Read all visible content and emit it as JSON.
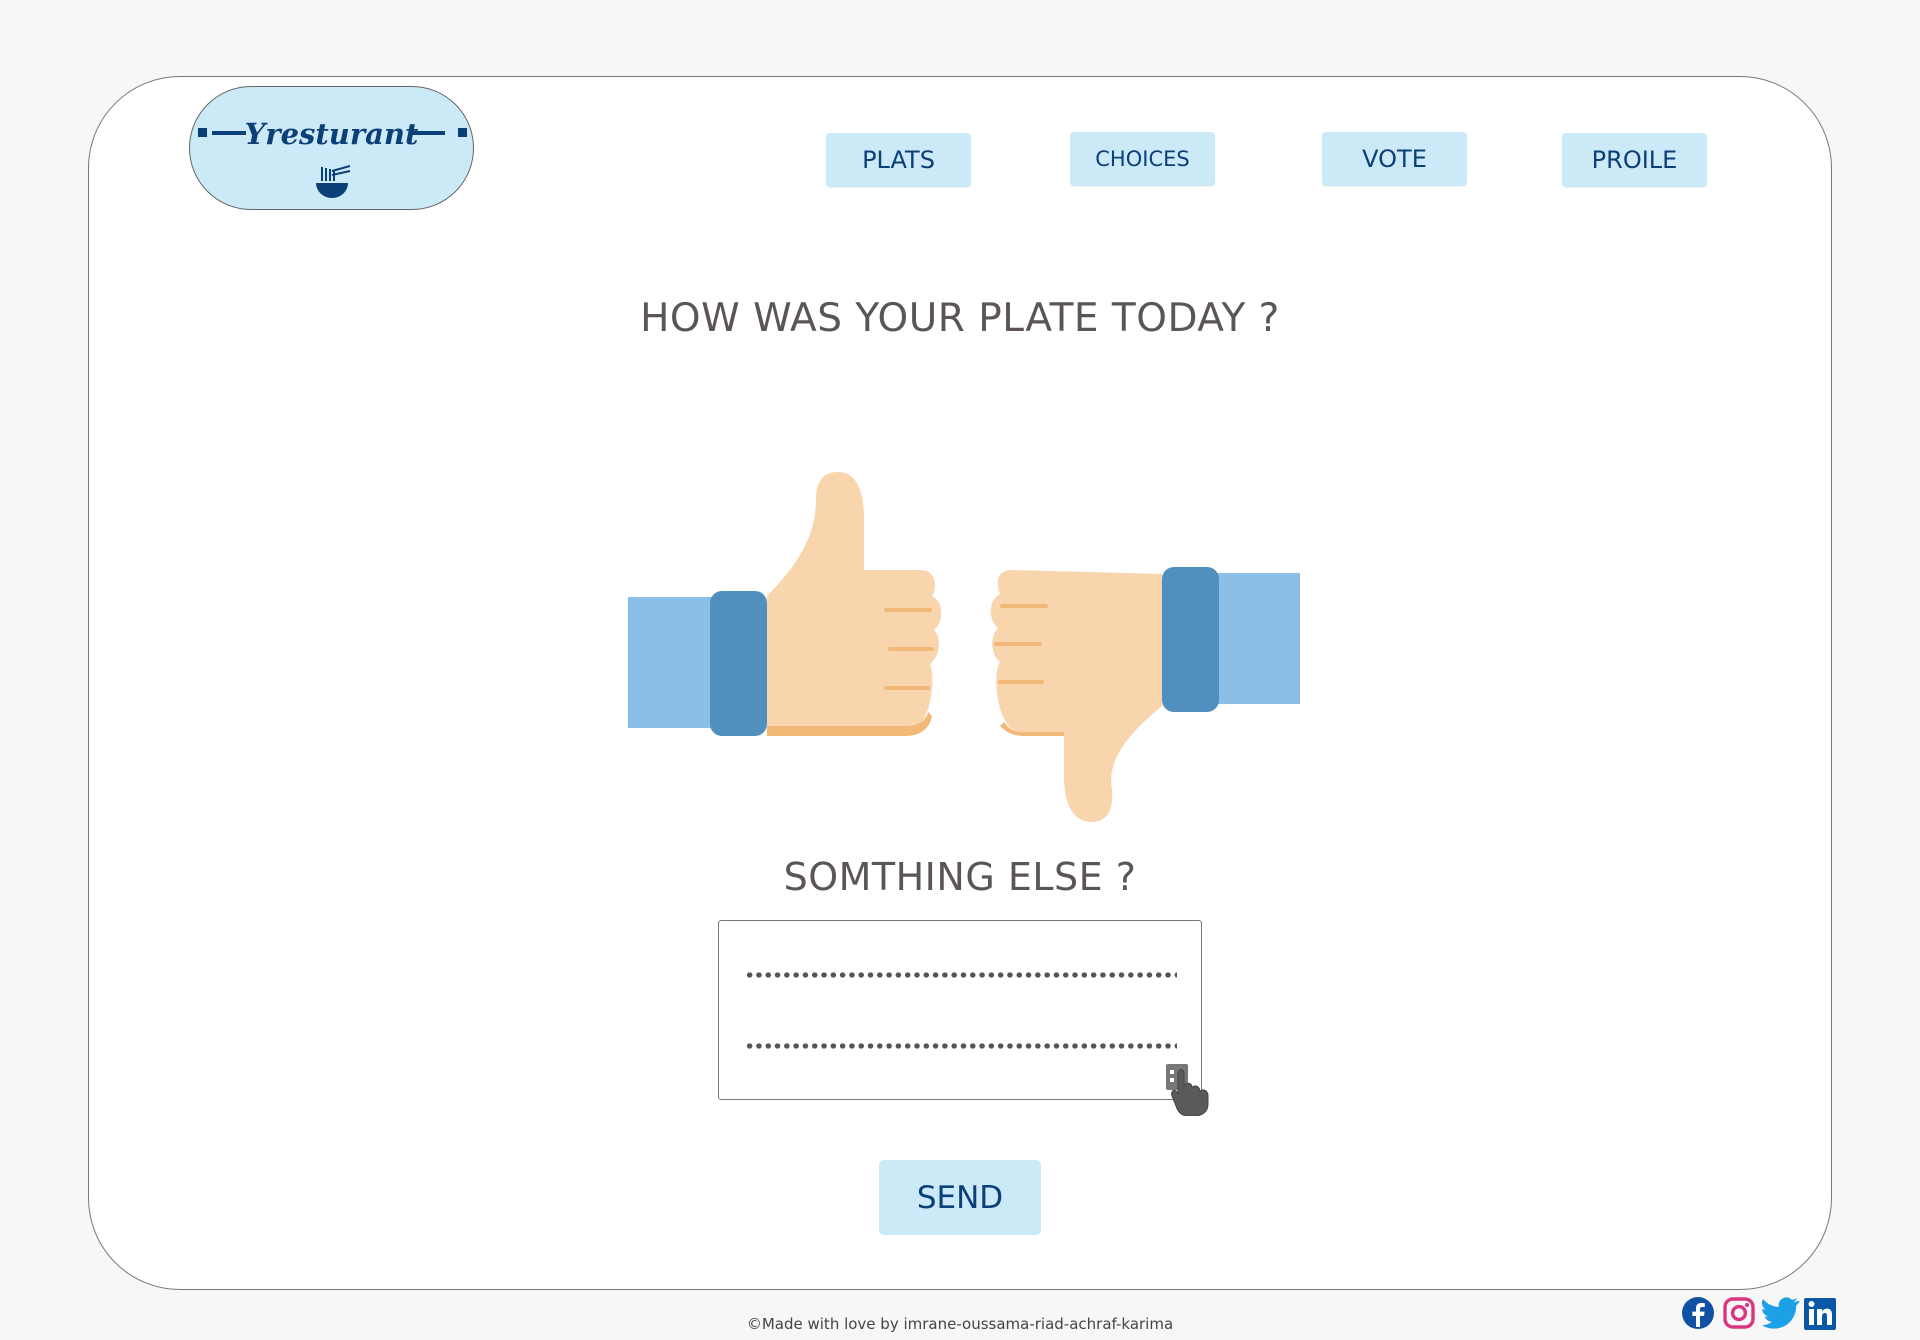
{
  "logo": {
    "name": "Yresturant"
  },
  "nav": {
    "plats": "PLATS",
    "choices": "CHOICES",
    "vote": "VOTE",
    "profile": "PROILE"
  },
  "main": {
    "question": "HOW WAS YOUR PLATE TODAY ?",
    "feedback_title": "SOMTHING ELSE ?",
    "send_label": "SEND"
  },
  "footer": {
    "credit": "©Made with love by  imrane-oussama-riad-achraf-karima"
  },
  "social": [
    "facebook-icon",
    "instagram-icon",
    "twitter-icon",
    "linkedin-icon"
  ],
  "colors": {
    "accent_bg": "#cce9f7",
    "accent_text": "#0b3f78",
    "heading_text": "#5b5555"
  }
}
